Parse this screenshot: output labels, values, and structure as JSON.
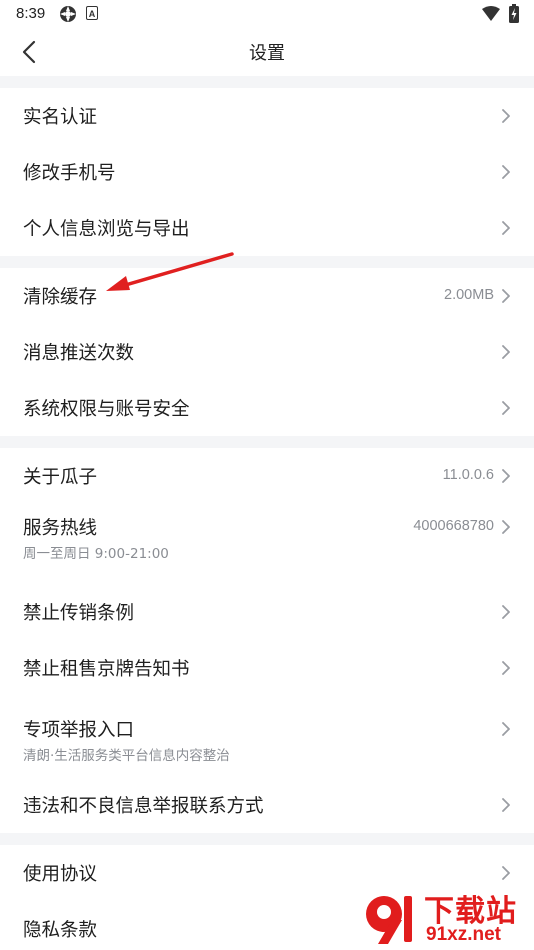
{
  "status": {
    "time": "8:39",
    "icons": [
      "sync-icon",
      "a-badge-icon",
      "wifi-icon",
      "battery-charging-icon"
    ],
    "badge_letter": "A"
  },
  "nav": {
    "title": "设置",
    "back_icon": "chevron-left-icon"
  },
  "groups": [
    {
      "items": [
        {
          "label": "实名认证"
        },
        {
          "label": "修改手机号"
        },
        {
          "label": "个人信息浏览与导出"
        }
      ]
    },
    {
      "items": [
        {
          "label": "清除缓存",
          "value": "2.00MB"
        },
        {
          "label": "消息推送次数"
        },
        {
          "label": "系统权限与账号安全"
        }
      ]
    },
    {
      "items": [
        {
          "label": "关于瓜子",
          "value": "11.0.0.6"
        },
        {
          "label": "服务热线",
          "sub": "周一至周日 9:00-21:00",
          "value": "4000668780"
        },
        {
          "label": "禁止传销条例"
        },
        {
          "label": "禁止租售京牌告知书"
        },
        {
          "label": "专项举报入口",
          "sub": "清朗·生活服务类平台信息内容整治"
        },
        {
          "label": "违法和不良信息举报联系方式"
        }
      ]
    },
    {
      "items": [
        {
          "label": "使用协议"
        },
        {
          "label": "隐私条款"
        }
      ]
    }
  ],
  "watermark": {
    "title": "下载站",
    "url": "91xz.net"
  },
  "colors": {
    "divider": "#f4f5f7",
    "secondary_text": "#8a8d93",
    "annotation_arrow": "#e02020",
    "watermark": "#e11d1d"
  }
}
